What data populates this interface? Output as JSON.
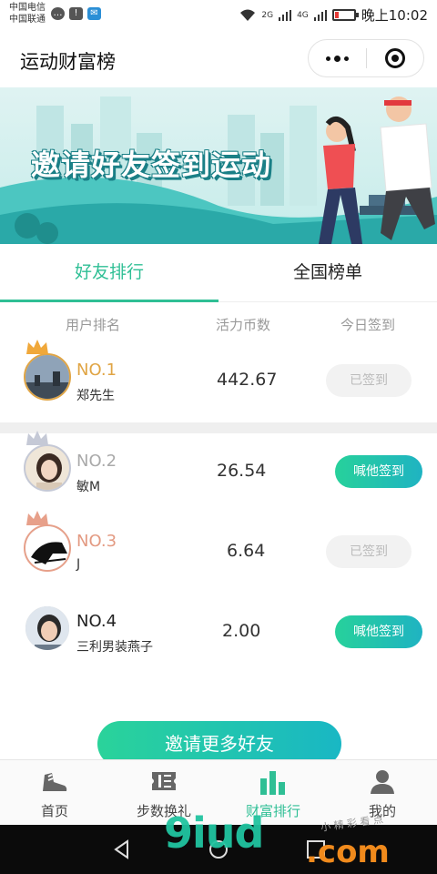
{
  "status_bar": {
    "carrier_1": "中国电信",
    "carrier_2": "中国联通",
    "signal_1": "2G",
    "signal_2": "4G",
    "time": "晚上10:02",
    "battery_level": 0.2
  },
  "title_bar": {
    "title": "运动财富榜"
  },
  "banner": {
    "text": "邀请好友签到运动"
  },
  "tabs": [
    {
      "label": "好友排行",
      "active": true
    },
    {
      "label": "全国榜单",
      "active": false
    }
  ],
  "columns": {
    "user_rank": "用户排名",
    "coins": "活力币数",
    "checkin": "今日签到"
  },
  "rows": [
    {
      "rank": "NO.1",
      "name": "郑先生",
      "coins": "442.67",
      "action": "已签到",
      "signed": true,
      "rank_color": "#e0a545"
    },
    {
      "rank": "NO.2",
      "name": "敏M",
      "coins": "26.54",
      "action": "喊他签到",
      "signed": false,
      "rank_color": "#aaaaaa"
    },
    {
      "rank": "NO.3",
      "name": "J",
      "coins": "6.64",
      "action": "已签到",
      "signed": true,
      "rank_color": "#e39a82"
    },
    {
      "rank": "NO.4",
      "name": "三利男装燕子",
      "coins": "2.00",
      "action": "喊他签到",
      "signed": false,
      "rank_color": "#222222"
    }
  ],
  "invite_button": "邀请更多好友",
  "bottom_nav": [
    {
      "label": "首页",
      "icon": "shoe-icon",
      "active": false
    },
    {
      "label": "步数换礼",
      "icon": "ticket-icon",
      "active": false
    },
    {
      "label": "财富排行",
      "icon": "bar-chart-icon",
      "active": true
    },
    {
      "label": "我的",
      "icon": "user-icon",
      "active": false
    }
  ],
  "watermark": {
    "brand": "9iud",
    "suffix": ".com",
    "small_text": "小 精 彩 看 点"
  },
  "colors": {
    "accent": "#2fbf95",
    "gradient_start": "#27d19b",
    "gradient_end": "#1fb3c2"
  }
}
